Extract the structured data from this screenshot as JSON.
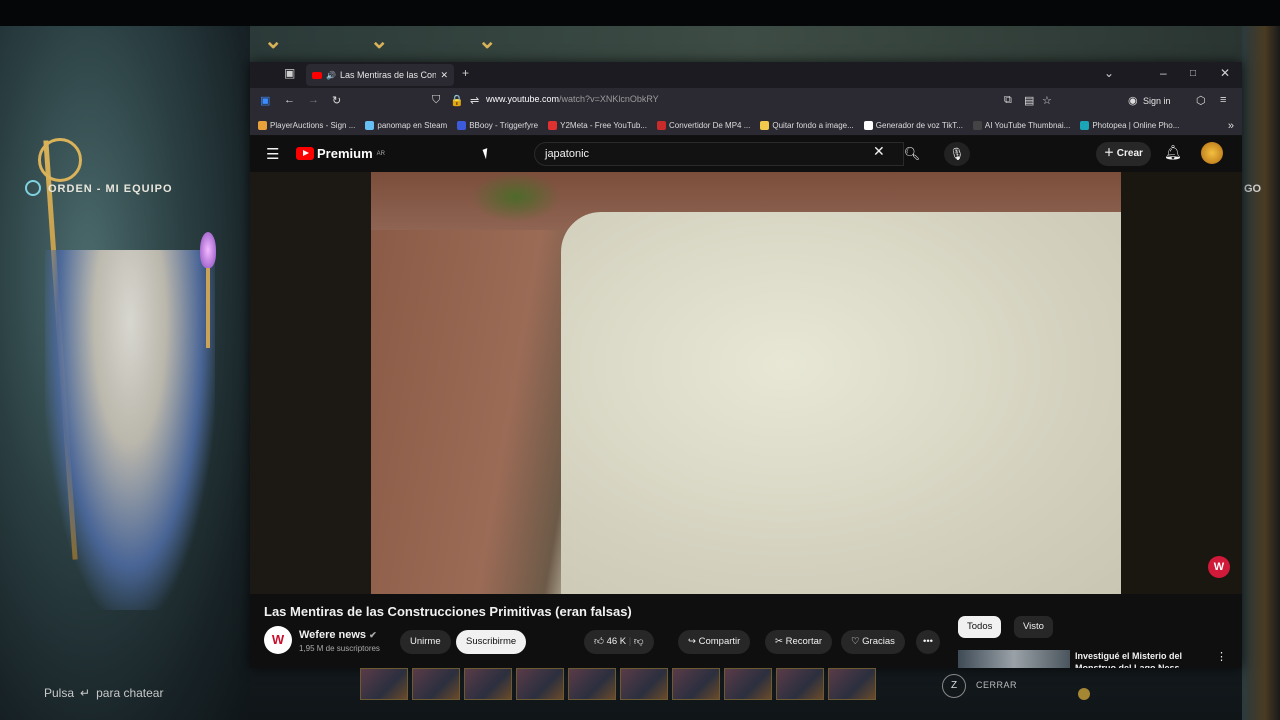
{
  "game": {
    "section_title": "ORDEN - MI EQUIPO",
    "right_label": "GO",
    "chat_hint_prefix": "Pulsa",
    "chat_hint_key": "↵",
    "chat_hint_suffix": "para chatear",
    "champions": [
      "champ-1",
      "champ-2",
      "champ-3",
      "champ-4",
      "champ-5",
      "champ-6",
      "champ-7",
      "champ-8",
      "champ-9",
      "champ-10"
    ],
    "close_key": "Z",
    "close_label": "CERRAR"
  },
  "browser": {
    "tab_title": "Las Mentiras de las Constr...",
    "url_domain": "www.youtube.com",
    "url_path": "/watch?v=XNKlcnObkRY",
    "signin_label": "Sign in",
    "bookmarks": [
      {
        "label": "PlayerAuctions - Sign ...",
        "color": "#e8a13a"
      },
      {
        "label": "panomap en Steam",
        "color": "#66c0f4"
      },
      {
        "label": "BBooy - Triggerfyre",
        "color": "#3b5bdb"
      },
      {
        "label": "Y2Meta - Free YouTub...",
        "color": "#e03131"
      },
      {
        "label": "Convertidor De MP4 ...",
        "color": "#c92a2a"
      },
      {
        "label": "Quitar fondo a image...",
        "color": "#f2c94c"
      },
      {
        "label": "Generador de voz TikT...",
        "color": "#ffffff"
      },
      {
        "label": "AI YouTube Thumbnai...",
        "color": "#444444"
      },
      {
        "label": "Photopea | Online Pho...",
        "color": "#1aa6b7"
      }
    ]
  },
  "youtube": {
    "logo_text": "Premium",
    "logo_region": "AR",
    "search_value": "japatonic",
    "create_label": "Crear",
    "video_title": "Las Mentiras de las Construcciones Primitivas (eran falsas)",
    "channel_initial": "W",
    "channel_name": "Wefere news",
    "channel_subs": "1,95 M de suscriptores",
    "join_label": "Unirme",
    "subscribe_label": "Suscribirme",
    "like_count": "46 K",
    "share_label": "Compartir",
    "clip_label": "Recortar",
    "thanks_label": "Gracias",
    "more_label": "•••",
    "chips": [
      "Todos",
      "Visto"
    ],
    "rec_title": "Investigué el Misterio del Monstruo del Lago Ness",
    "badge": "W"
  },
  "colors": {
    "accent": "#ff0000",
    "badge": "#d11a3a"
  }
}
